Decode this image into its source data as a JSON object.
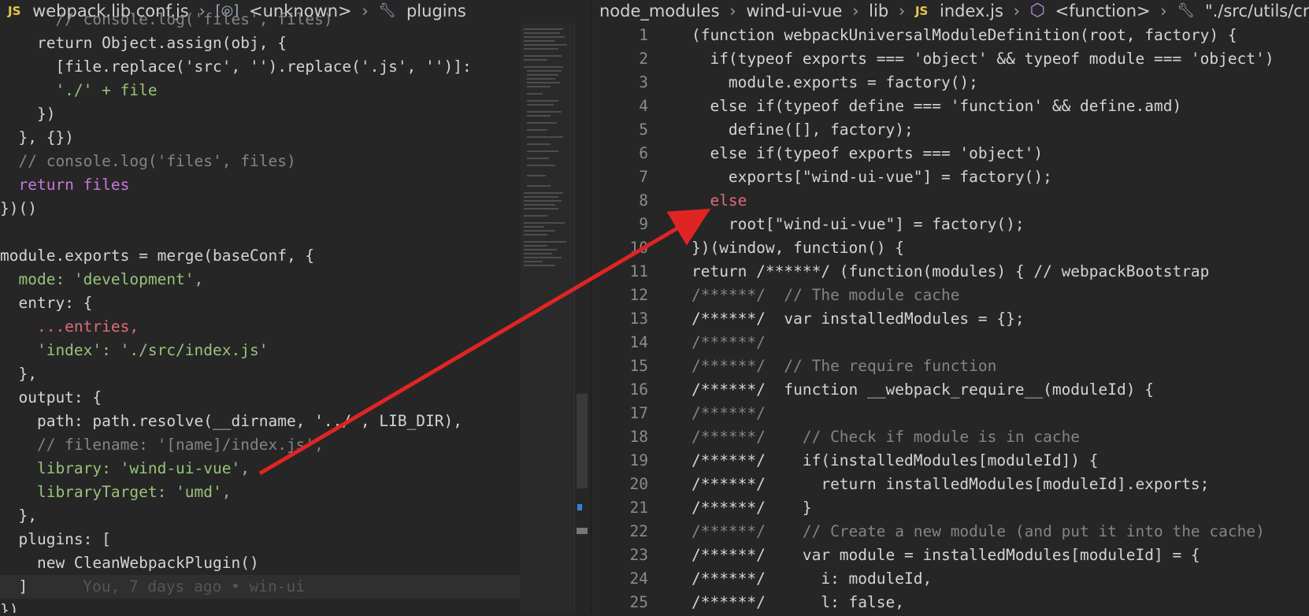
{
  "left_editor": {
    "breadcrumbs": [
      "webpack.lib.conf.js",
      "<unknown>",
      "plugins"
    ],
    "lines": [
      "  // console.log('files', files)",
      "    return Object.assign(obj, {",
      "      [file.replace('src', '').replace('.js', '')]:",
      "      './' + file",
      "    })",
      "  }, {})",
      "  // console.log('files', files)",
      "  return files",
      "})()",
      "",
      "module.exports = merge(baseConf, {",
      "  mode: 'development',",
      "  entry: {",
      "    ...entries,",
      "    'index': './src/index.js'",
      "  },",
      "  output: {",
      "    path: path.resolve(__dirname, '../', LIB_DIR),",
      "    // filename: '[name]/index.js',",
      "    library: 'wind-ui-vue',",
      "    libraryTarget: 'umd',",
      "  },",
      "  plugins: [",
      "    new CleanWebpackPlugin()",
      "  ]",
      "})"
    ],
    "blame": "You, 7 days ago • win-ui"
  },
  "right_editor": {
    "breadcrumbs": [
      "node_modules",
      "wind-ui-vue",
      "lib",
      "index.js",
      "<function>",
      "\"./src/utils/crea"
    ],
    "line_numbers": [
      "1",
      "2",
      "3",
      "4",
      "5",
      "6",
      "7",
      "8",
      "9",
      "10",
      "11",
      "12",
      "13",
      "14",
      "15",
      "16",
      "17",
      "18",
      "19",
      "20",
      "21",
      "22",
      "23",
      "24",
      "25"
    ],
    "lines": [
      "(function webpackUniversalModuleDefinition(root, factory) {",
      "  if(typeof exports === 'object' && typeof module === 'object')",
      "    module.exports = factory();",
      "  else if(typeof define === 'function' && define.amd)",
      "    define([], factory);",
      "  else if(typeof exports === 'object')",
      "    exports[\"wind-ui-vue\"] = factory();",
      "  else",
      "    root[\"wind-ui-vue\"] = factory();",
      "})(window, function() {",
      "return /******/ (function(modules) { // webpackBootstrap",
      "/******/  // The module cache",
      "/******/  var installedModules = {};",
      "/******/",
      "/******/  // The require function",
      "/******/  function __webpack_require__(moduleId) {",
      "/******/",
      "/******/    // Check if module is in cache",
      "/******/    if(installedModules[moduleId]) {",
      "/******/      return installedModules[moduleId].exports;",
      "/******/    }",
      "/******/    // Create a new module (and put it into the cache)",
      "/******/    var module = installedModules[moduleId] = {",
      "/******/      i: moduleId,",
      "/******/      l: false,"
    ]
  },
  "colors": {
    "arrow": "#e02424",
    "background": "#262626"
  }
}
